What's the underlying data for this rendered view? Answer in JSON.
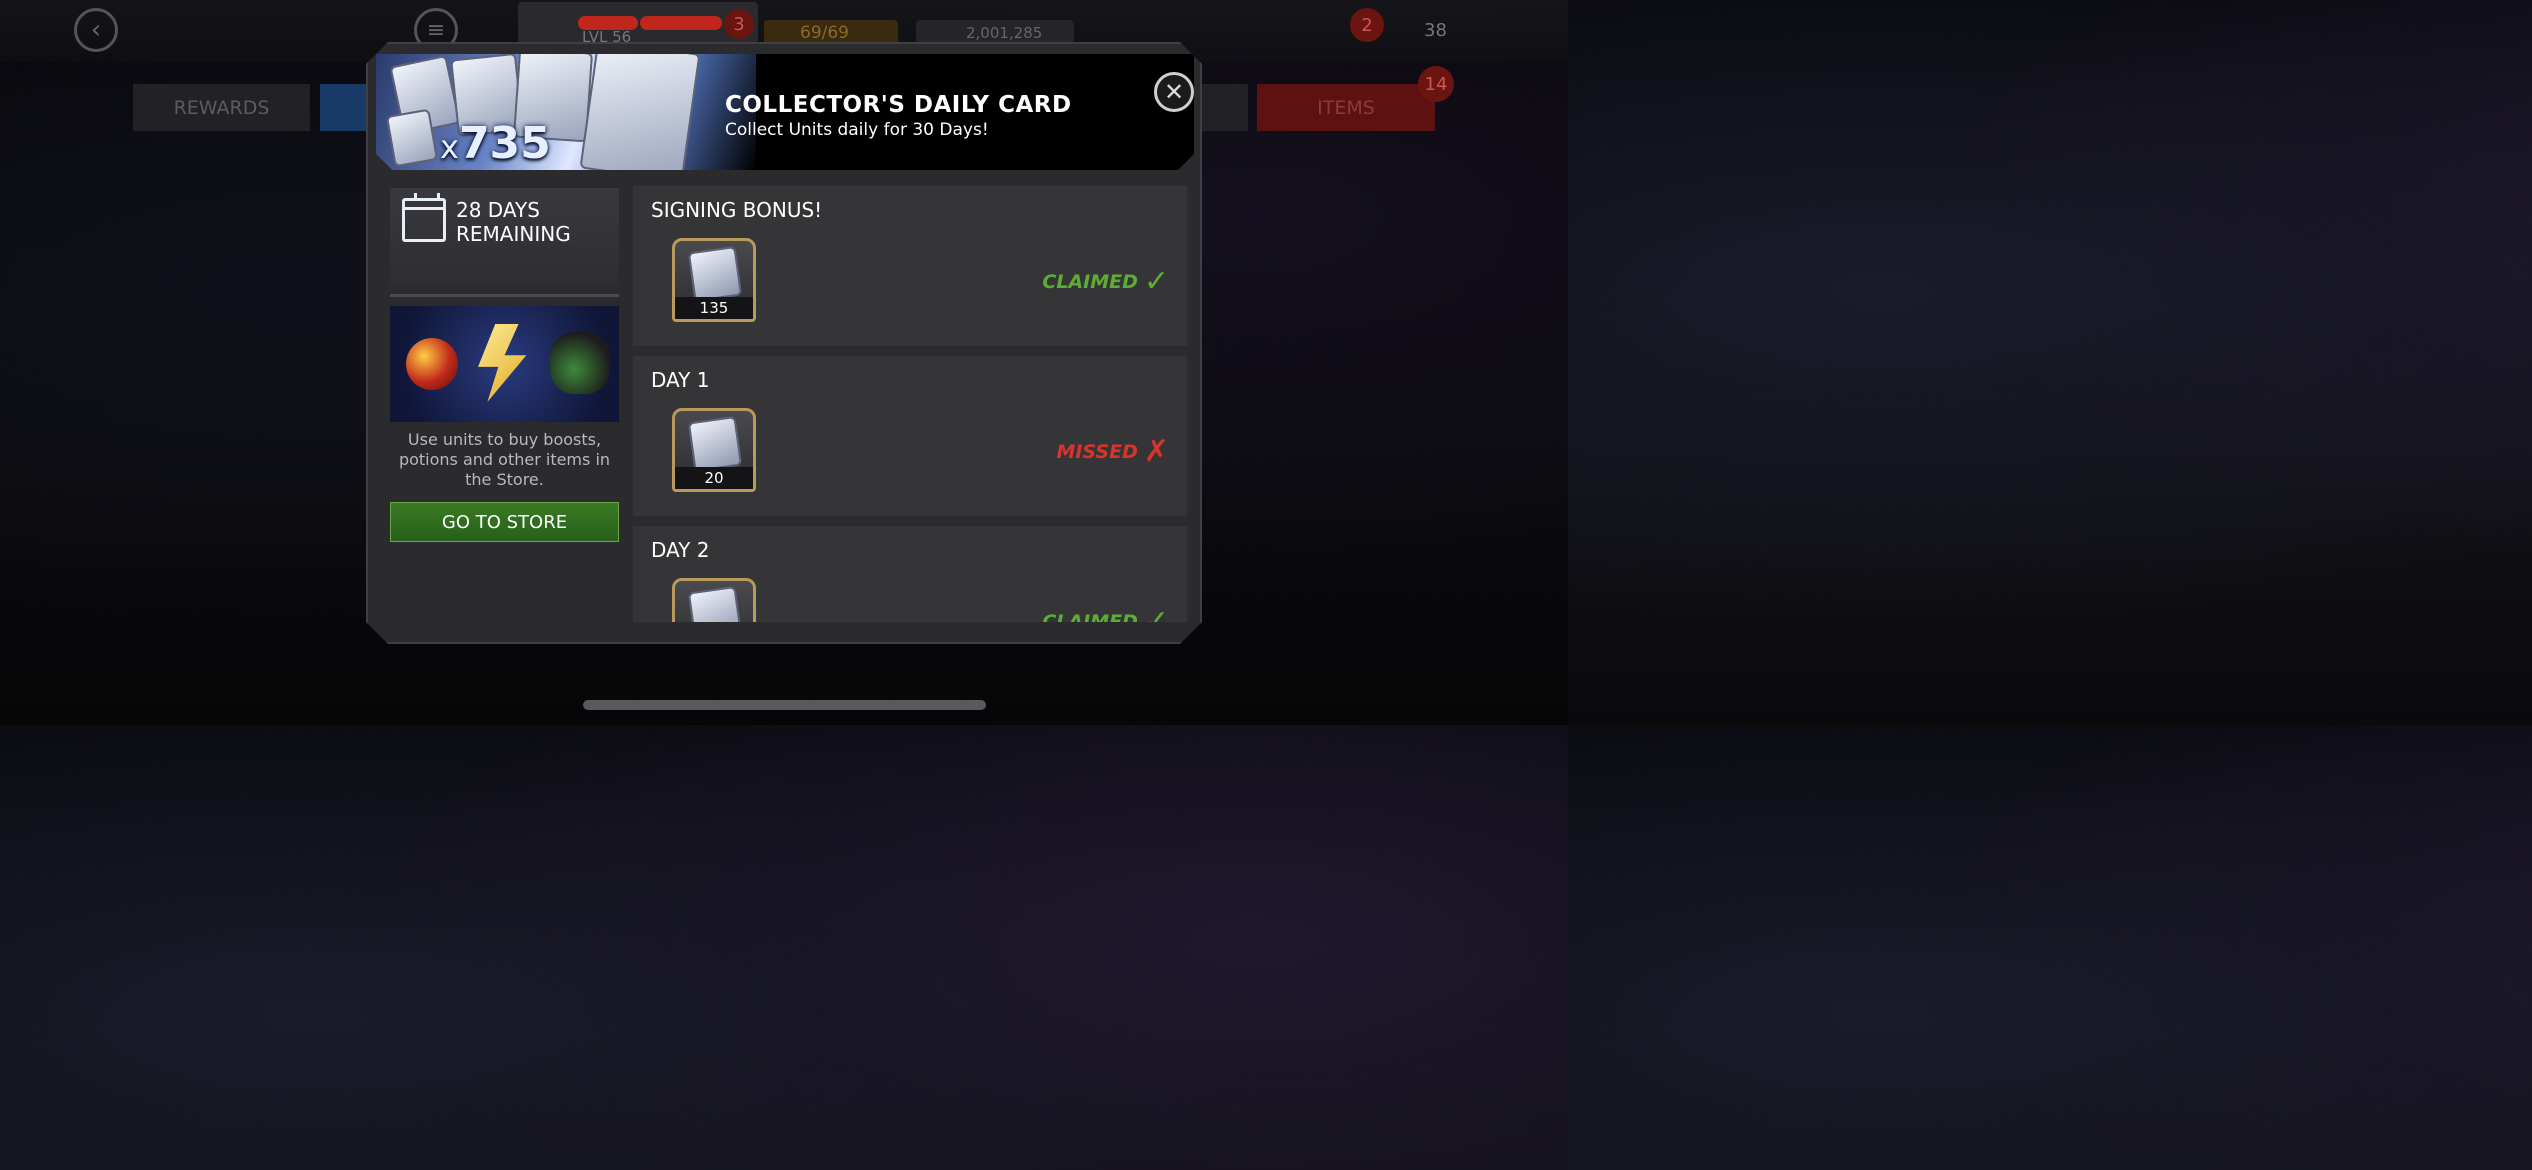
{
  "hud": {
    "level": "LVL 56",
    "alliance_badge": "3",
    "energy": "69/69",
    "gold": "2,001,285",
    "notif_badge": "2",
    "units": "38"
  },
  "tabs": {
    "rewards": "REWARDS",
    "items": "ITEMS",
    "items_badge": "14"
  },
  "modal": {
    "banner": {
      "x_prefix": "x",
      "count": "735",
      "title": "COLLECTOR'S DAILY CARD",
      "subtitle": "Collect Units daily for 30 Days!"
    },
    "days_remaining_line1": "28 DAYS",
    "days_remaining_line2": "REMAINING",
    "store_description": "Use units to buy boosts, potions and other items in the Store.",
    "store_button": "GO TO STORE",
    "rows": [
      {
        "title": "SIGNING BONUS!",
        "qty": "135",
        "status": "CLAIMED"
      },
      {
        "title": "DAY 1",
        "qty": "20",
        "status": "MISSED"
      },
      {
        "title": "DAY 2",
        "qty": "",
        "status": "CLAIMED"
      }
    ]
  },
  "colors": {
    "claimed": "#5cad32",
    "missed": "#d9342b",
    "store_button": "#2f6b1e"
  }
}
